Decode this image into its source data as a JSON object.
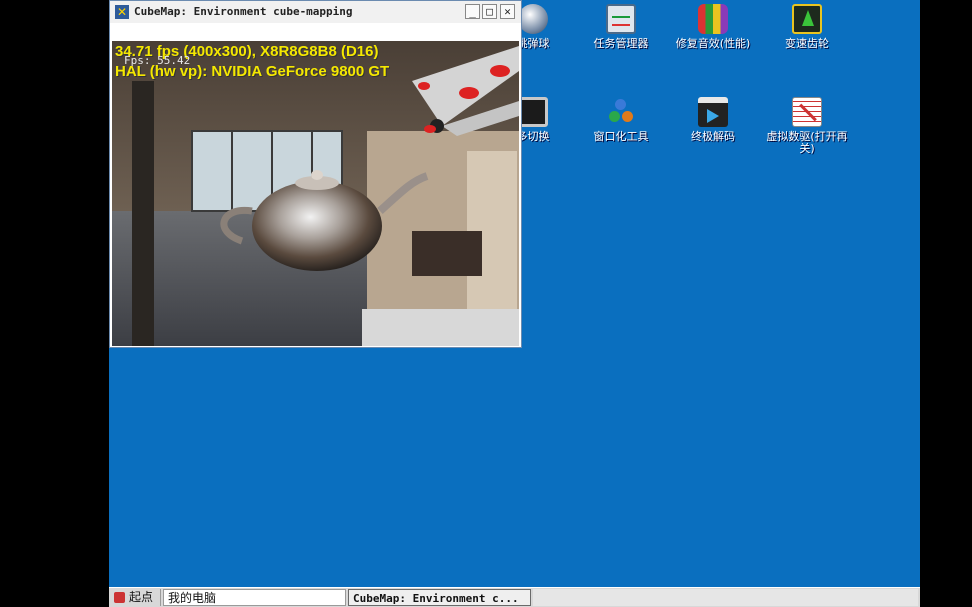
{
  "window": {
    "title": "CubeMap: Environment cube-mapping",
    "icon": "x-app-icon",
    "controls": {
      "minimize": "_",
      "maximize": "□",
      "close": "✕"
    },
    "hud": {
      "line1": "34.71 fps (400x300), X8R8G8B8 (D16)",
      "line2": "HAL (hw vp): NVIDIA GeForce 9800 GT",
      "fps_overlay": "Fps: 55.42"
    }
  },
  "desktop_icons": [
    {
      "label": "跳弹球",
      "icon": "pinball-icon"
    },
    {
      "label": "任务管理器",
      "icon": "task-manager-icon"
    },
    {
      "label": "修复音效(性能)",
      "icon": "audio-repair-icon"
    },
    {
      "label": "变速齿轮",
      "icon": "speed-gear-icon"
    },
    {
      "label": "多切换",
      "icon": "monitor-switch-icon"
    },
    {
      "label": "窗口化工具",
      "icon": "window-tool-icon"
    },
    {
      "label": "终极解码",
      "icon": "codec-icon"
    },
    {
      "label": "虚拟数驱(打开再关)",
      "icon": "virtual-drive-icon"
    }
  ],
  "taskbar": {
    "start_label": "起点",
    "my_computer": "我的电脑",
    "active_task": "CubeMap: Environment c..."
  },
  "colors": {
    "desktop": "#0a6fbf",
    "hud_text": "#f5e800",
    "taskbar": "#d8d8d8"
  }
}
